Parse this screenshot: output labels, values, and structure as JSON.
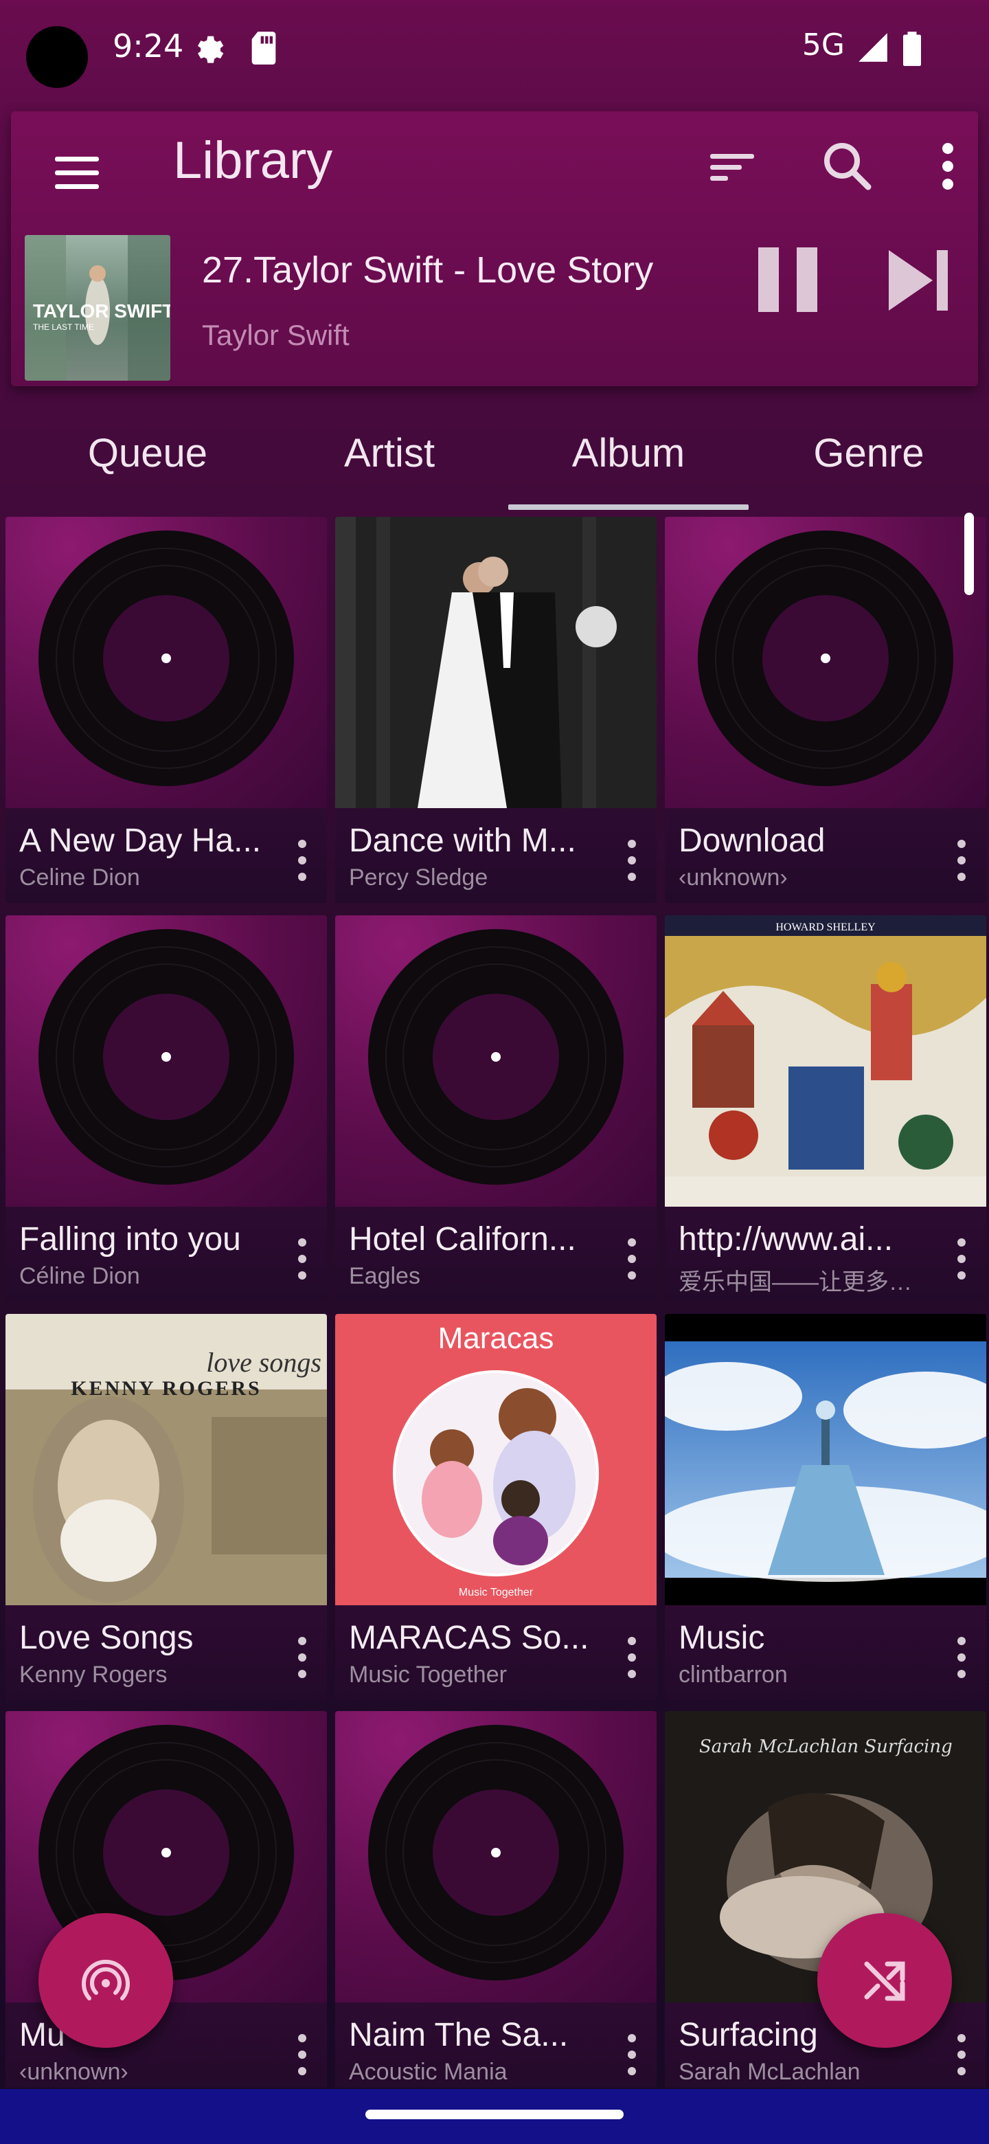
{
  "status_bar": {
    "time": "9:24",
    "network": "5G"
  },
  "header": {
    "title": "Library",
    "icons": [
      "menu-icon",
      "sort-icon",
      "search-icon",
      "more-vert-icon"
    ]
  },
  "now_playing": {
    "title": "27.Taylor Swift - Love Story",
    "artist": "Taylor Swift",
    "art_text_line1": "TAYLOR SWIFT",
    "art_text_line2": "THE LAST TIME"
  },
  "tabs": [
    {
      "label": "Queue",
      "selected": false
    },
    {
      "label": "Artist",
      "selected": false
    },
    {
      "label": "Album",
      "selected": true
    },
    {
      "label": "Genre",
      "selected": false
    }
  ],
  "albums": [
    {
      "title": "A New Day Ha...",
      "artist": "Celine Dion"
    },
    {
      "title": "Dance with M...",
      "artist": "Percy Sledge"
    },
    {
      "title": "Download",
      "artist": "‹unknown›"
    },
    {
      "title": "Falling into you",
      "artist": "Céline Dion"
    },
    {
      "title": "Hotel Californ...",
      "artist": "Eagles"
    },
    {
      "title": "http://www.ai...",
      "artist": "爱乐中国——让更多的人"
    },
    {
      "title": "Love Songs",
      "artist": "Kenny Rogers"
    },
    {
      "title": "MARACAS So...",
      "artist": "Music Together"
    },
    {
      "title": "Music",
      "artist": "clintbarron"
    },
    {
      "title": "Mu",
      "artist": "‹unknown›"
    },
    {
      "title": "Naim The Sa...",
      "artist": "Acoustic Mania"
    },
    {
      "title": "Surfacing",
      "artist": "Sarah McLachlan"
    }
  ],
  "art_text": {
    "love_songs_line1": "love songs",
    "love_songs_line2": "KENNY ROGERS",
    "maracas_title": "Maracas",
    "maracas_footer": "Music Together",
    "shelley_header": "HOWARD SHELLEY",
    "surfacing_script": "Sarah McLachlan Surfacing"
  },
  "fabs": {
    "left": "broadcast-icon",
    "right": "shuffle-icon"
  },
  "colors": {
    "accent": "#b01a5c",
    "header": "#790e58",
    "nav": "#13108a"
  }
}
